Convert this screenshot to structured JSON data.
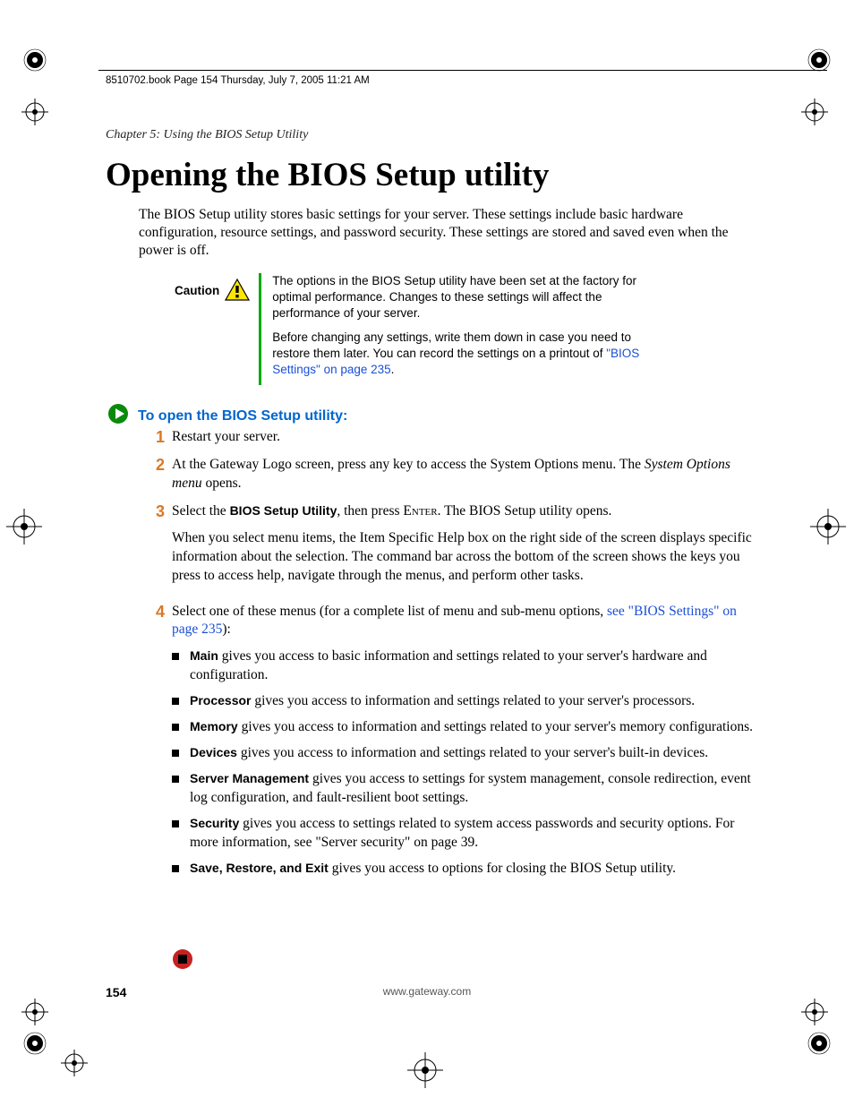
{
  "header": {
    "book_info": "8510702.book  Page 154  Thursday, July 7, 2005  11:21 AM"
  },
  "chapter_label": "Chapter 5: Using the BIOS Setup Utility",
  "title": "Opening the BIOS Setup utility",
  "intro": "The BIOS Setup utility stores basic settings for your server. These settings include basic hardware configuration, resource settings, and password security. These settings are stored and saved even when the power is off.",
  "caution": {
    "label": "Caution",
    "para1": "The options in the BIOS Setup utility have been set at the factory for optimal performance. Changes to these settings will affect the performance of your server.",
    "para2_a": "Before changing any settings, write them down in case you need to restore them later. You can record the settings on a printout of ",
    "para2_link": "\"BIOS Settings\" on page 235",
    "para2_b": "."
  },
  "procedure": {
    "title": "To open the BIOS Setup utility:"
  },
  "steps": {
    "s1": "Restart your server.",
    "s2_a": "At the Gateway Logo screen, press any key to access the System Options menu. The ",
    "s2_em": "System Options menu",
    "s2_b": " opens.",
    "s3_a": "Select the ",
    "s3_bold": "BIOS Setup Utility",
    "s3_b": ", then press ",
    "s3_key": "Enter",
    "s3_c": ". The BIOS Setup utility opens.",
    "s3_p2": "When you select menu items, the Item Specific Help box on the right side of the screen displays specific information about the selection. The command bar across the bottom of the screen shows the keys you press to access help, navigate through the menus, and perform other tasks.",
    "s4_a": "Select one of these menus (for a complete list of menu and sub-menu options, ",
    "s4_link": "see \"BIOS Settings\" on page 235",
    "s4_b": "):"
  },
  "bullets": {
    "b1_bold": "Main",
    "b1": " gives you access to basic information and settings related to your server's hardware and configuration.",
    "b2_bold": "Processor",
    "b2": " gives you access to information and settings related to your server's processors.",
    "b3_bold": "Memory",
    "b3": " gives you access to information and settings related to your server's memory configurations.",
    "b4_bold": "Devices",
    "b4": " gives you access to information and settings related to your server's built-in devices.",
    "b5_bold": "Server Management",
    "b5": " gives you access to settings for system management, console redirection, event log configuration, and fault-resilient boot settings.",
    "b6_bold": "Security",
    "b6": " gives you access to settings related to system access passwords and security options. For more information, see \"Server security\" on page 39.",
    "b7_bold": "Save, Restore, and Exit",
    "b7": " gives you access to options for closing the BIOS Setup utility."
  },
  "footer": {
    "page": "154",
    "url": "www.gateway.com"
  }
}
